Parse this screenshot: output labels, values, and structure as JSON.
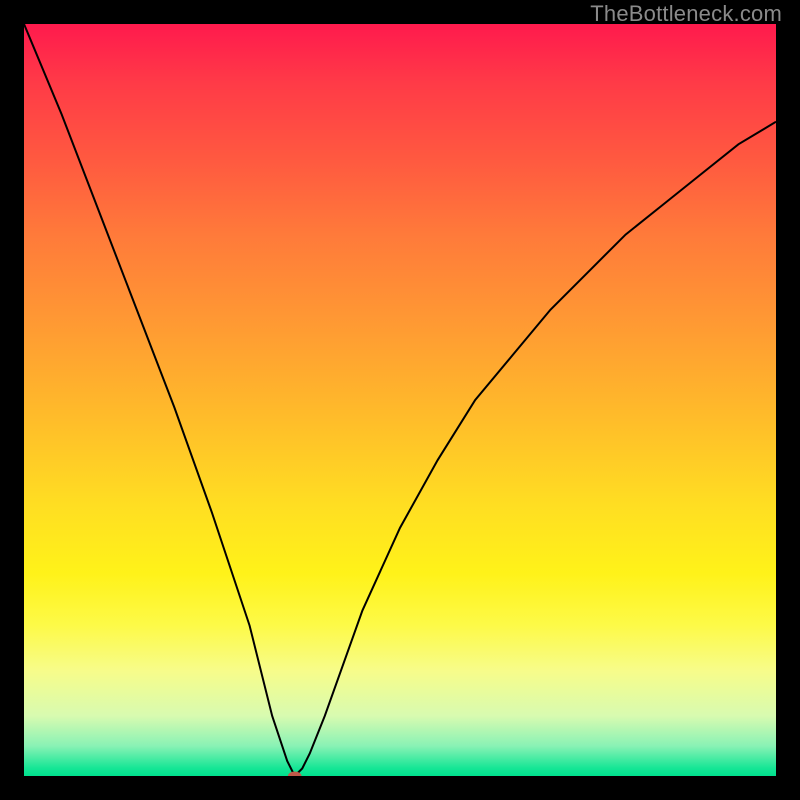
{
  "watermark": "TheBottleneck.com",
  "chart_data": {
    "type": "line",
    "title": "",
    "xlabel": "",
    "ylabel": "",
    "xlim": [
      0,
      100
    ],
    "ylim": [
      0,
      100
    ],
    "gradient_colors": {
      "top": "#ff1a4d",
      "upper_mid": "#ff9a33",
      "mid": "#ffde22",
      "lower_mid": "#fdfa48",
      "bottom": "#00e08e"
    },
    "min_point": {
      "x": 36,
      "y": 0
    },
    "series": [
      {
        "name": "bottleneck-curve",
        "x": [
          0,
          5,
          10,
          15,
          20,
          25,
          30,
          33,
          35,
          36,
          37,
          38,
          40,
          45,
          50,
          55,
          60,
          65,
          70,
          75,
          80,
          85,
          90,
          95,
          100
        ],
        "y": [
          100,
          88,
          75,
          62,
          49,
          35,
          20,
          8,
          2,
          0,
          1,
          3,
          8,
          22,
          33,
          42,
          50,
          56,
          62,
          67,
          72,
          76,
          80,
          84,
          87
        ]
      }
    ],
    "marker": {
      "x": 36,
      "y": 0,
      "color": "#c05a4a"
    }
  }
}
